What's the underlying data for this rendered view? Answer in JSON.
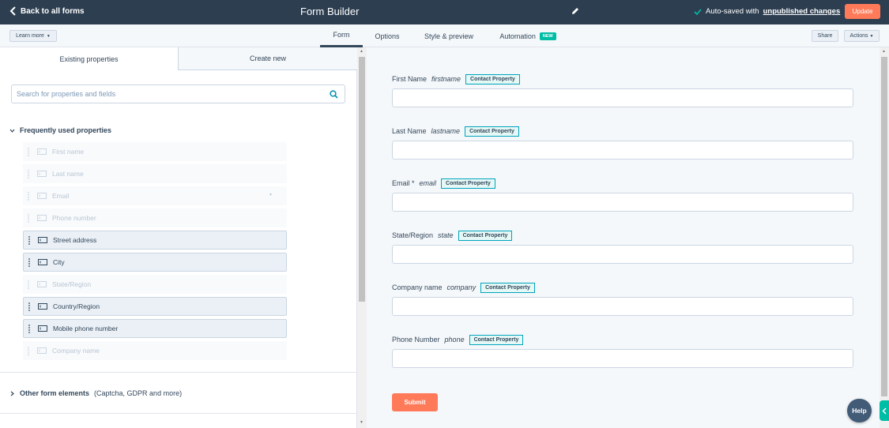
{
  "topbar": {
    "back_label": "Back to all forms",
    "title": "Form Builder",
    "autosave_text": "Auto-saved with",
    "autosave_link": "unpublished changes",
    "update_label": "Update"
  },
  "subnav": {
    "learn_more": "Learn more",
    "tabs": [
      {
        "label": "Form"
      },
      {
        "label": "Options"
      },
      {
        "label": "Style & preview"
      },
      {
        "label": "Automation",
        "badge": "NEW"
      }
    ],
    "share_label": "Share",
    "actions_label": "Actions"
  },
  "left": {
    "tab_existing": "Existing properties",
    "tab_create": "Create new",
    "search_placeholder": "Search for properties and fields",
    "section_frequent": "Frequently used properties",
    "properties": [
      {
        "label": "First name",
        "enabled": false
      },
      {
        "label": "Last name",
        "enabled": false
      },
      {
        "label": "Email",
        "enabled": false
      },
      {
        "label": "Phone number",
        "enabled": false
      },
      {
        "label": "Street address",
        "enabled": true
      },
      {
        "label": "City",
        "enabled": true
      },
      {
        "label": "State/Region",
        "enabled": false
      },
      {
        "label": "Country/Region",
        "enabled": true
      },
      {
        "label": "Mobile phone number",
        "enabled": true
      },
      {
        "label": "Company name",
        "enabled": false
      }
    ],
    "section_other": "Other form elements",
    "section_other_sub": "(Captcha, GDPR and more)"
  },
  "preview": {
    "badge_label": "Contact Property",
    "fields": [
      {
        "label": "First Name",
        "api": "firstname"
      },
      {
        "label": "Last Name",
        "api": "lastname"
      },
      {
        "label": "Email *",
        "api": "email"
      },
      {
        "label": "State/Region",
        "api": "state"
      },
      {
        "label": "Company name",
        "api": "company"
      },
      {
        "label": "Phone Number",
        "api": "phone"
      }
    ],
    "submit_label": "Submit"
  },
  "help_label": "Help",
  "colors": {
    "topbar": "#2d3e50",
    "accent": "#ff7a59",
    "teal": "#00bda5"
  }
}
